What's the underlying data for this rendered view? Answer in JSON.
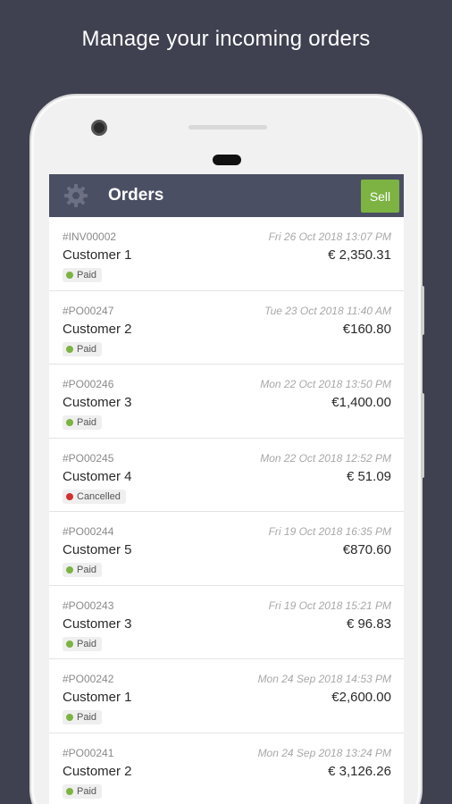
{
  "headline": "Manage your incoming orders",
  "appbar": {
    "title": "Orders",
    "sell_label": "Sell",
    "settings_icon": "gear-icon"
  },
  "colors": {
    "background": "#3f4150",
    "appbar": "#4b4f63",
    "sell_button": "#7cb342",
    "paid": "#7cb342",
    "cancelled": "#d32f2f"
  },
  "orders": [
    {
      "id": "#INV00002",
      "date": "Fri 26 Oct 2018 13:07 PM",
      "customer": "Customer 1",
      "amount": "€ 2,350.31",
      "status": "Paid"
    },
    {
      "id": "#PO00247",
      "date": "Tue 23 Oct 2018 11:40 AM",
      "customer": "Customer 2",
      "amount": "€160.80",
      "status": "Paid"
    },
    {
      "id": "#PO00246",
      "date": "Mon 22 Oct 2018 13:50 PM",
      "customer": "Customer 3",
      "amount": "€1,400.00",
      "status": "Paid"
    },
    {
      "id": "#PO00245",
      "date": "Mon 22 Oct 2018 12:52 PM",
      "customer": "Customer 4",
      "amount": "€ 51.09",
      "status": "Cancelled"
    },
    {
      "id": "#PO00244",
      "date": "Fri 19 Oct 2018 16:35 PM",
      "customer": "Customer 5",
      "amount": "€870.60",
      "status": "Paid"
    },
    {
      "id": "#PO00243",
      "date": "Fri 19 Oct 2018 15:21 PM",
      "customer": "Customer 3",
      "amount": "€ 96.83",
      "status": "Paid"
    },
    {
      "id": "#PO00242",
      "date": "Mon 24 Sep 2018 14:53 PM",
      "customer": "Customer 1",
      "amount": "€2,600.00",
      "status": "Paid"
    },
    {
      "id": "#PO00241",
      "date": "Mon 24 Sep 2018 13:24 PM",
      "customer": "Customer 2",
      "amount": "€ 3,126.26",
      "status": "Paid"
    }
  ]
}
